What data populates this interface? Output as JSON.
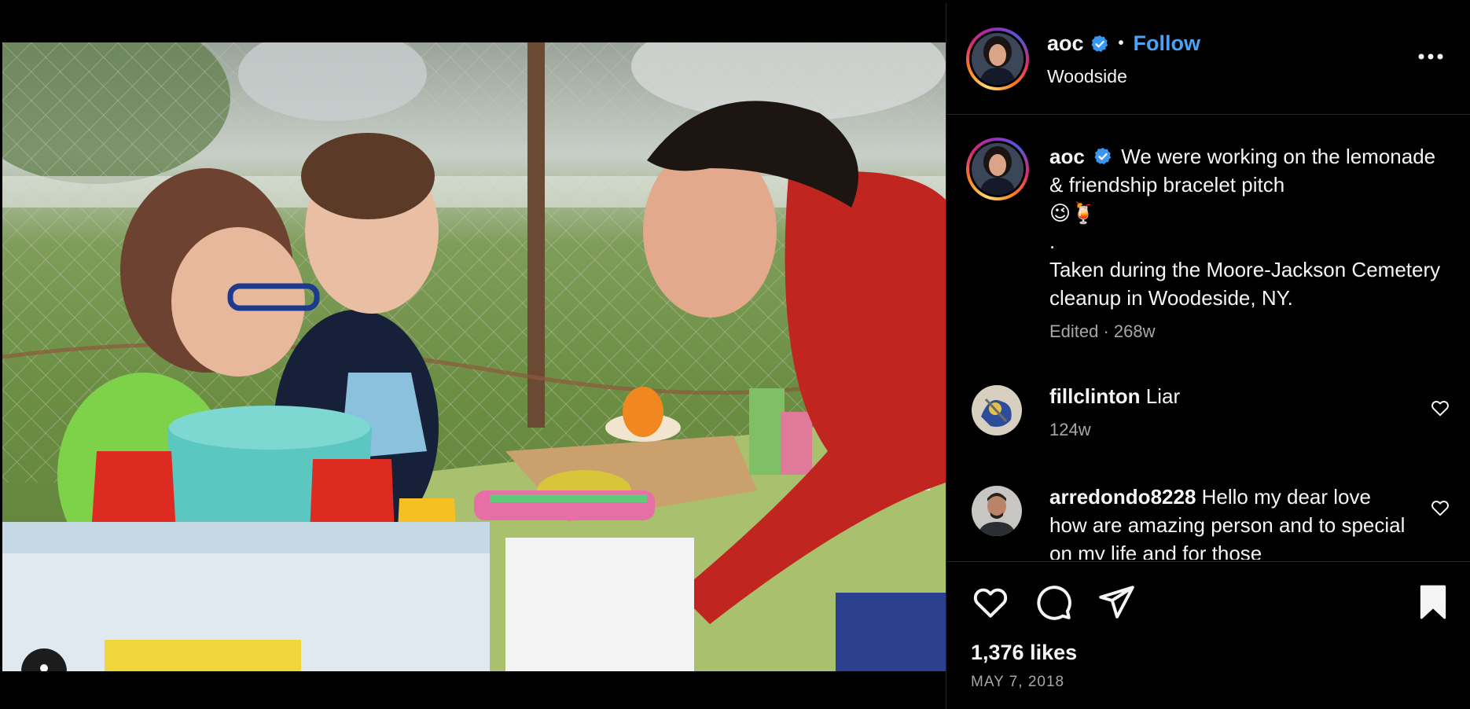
{
  "post": {
    "author": "aoc",
    "follow_label": "Follow",
    "separator": "•",
    "location": "Woodside"
  },
  "caption": {
    "username": "aoc",
    "text_line1": "We were working on the lemonade & friendship bracelet pitch",
    "emojis": "😉🍹",
    "dot_line": ".",
    "text_line2": "Taken during the Moore-Jackson Cemetery cleanup in Woodeside, NY.",
    "meta": "Edited · 268w"
  },
  "comments": [
    {
      "username": "fillclinton",
      "text": "Liar",
      "meta": "124w"
    },
    {
      "username": "arredondo8228",
      "text": "Hello my dear love how are amazing person and to special on my life and for those",
      "meta": ""
    }
  ],
  "stats": {
    "likes": "1,376 likes",
    "date": "MAY 7, 2018"
  },
  "icons": {
    "verified": "verified-badge-icon",
    "more": "more-options-icon",
    "like": "heart-icon",
    "comment": "comment-icon",
    "share": "send-icon",
    "save": "bookmark-icon",
    "user_tag": "user-icon"
  },
  "colors": {
    "accent": "#4aa3f7",
    "verified": "#3897f0",
    "background": "#000000",
    "muted_text": "#a8a8a8"
  }
}
